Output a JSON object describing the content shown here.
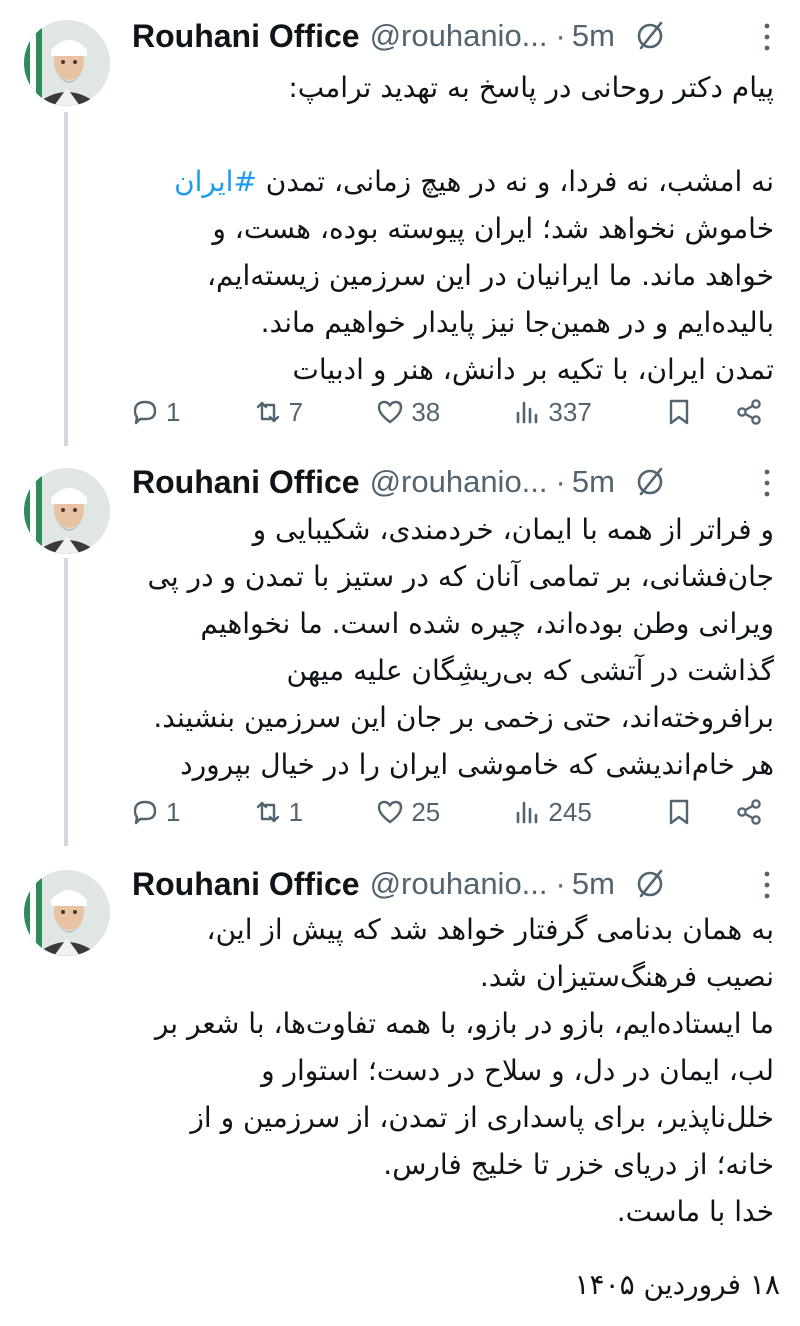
{
  "tweets": [
    {
      "author": {
        "name": "Rouhani Office",
        "handle": "@rouhanio...",
        "separator": "·",
        "time": "5m"
      },
      "lines": [
        {
          "text": "پیام دکتر روحانی در پاسخ به تهدید ترامپ:"
        },
        {
          "text": ""
        },
        {
          "before": "نه امشب، نه فردا، و نه در هیچ زمانی، تمدن ",
          "hashtag": "#ایران",
          "after": ""
        },
        {
          "text": "خاموش نخواهد شد؛ ایران پیوسته بوده، هست، و"
        },
        {
          "text": "خواهد ماند. ما ایرانیان در این سرزمین زیسته‌ایم،"
        },
        {
          "text": "بالیده‌ایم و در همین‌جا نیز پایدار خواهیم ماند."
        },
        {
          "text": "تمدن ایران، با تکیه بر دانش، هنر و ادبیات"
        }
      ],
      "stats": {
        "replies": "1",
        "reposts": "7",
        "likes": "38",
        "views": "337"
      }
    },
    {
      "author": {
        "name": "Rouhani Office",
        "handle": "@rouhanio...",
        "separator": "·",
        "time": "5m"
      },
      "lines": [
        {
          "text": "و فراتر از همه با ایمان، خردمندی، شکیبایی و"
        },
        {
          "text": "جان‌فشانی، بر تمامی آنان که در ستیز با تمدن و در پی"
        },
        {
          "text": "ویرانی وطن بوده‌اند، چیره شده است. ما نخواهیم"
        },
        {
          "text": "گذاشت در آتشی که بی‌ریشِگان علیه میهن"
        },
        {
          "text": "برافروخته‌اند، حتی زخمی بر جان این سرزمین بنشیند."
        },
        {
          "text": "هر خام‌اندیشی که خاموشی ایران را در خیال بپرورد"
        }
      ],
      "stats": {
        "replies": "1",
        "reposts": "1",
        "likes": "25",
        "views": "245"
      }
    },
    {
      "author": {
        "name": "Rouhani Office",
        "handle": "@rouhanio...",
        "separator": "·",
        "time": "5m"
      },
      "lines": [
        {
          "text": "به همان بدنامی گرفتار خواهد شد که پیش از این،"
        },
        {
          "text": "نصیب فرهنگ‌ستیزان شد."
        },
        {
          "text": "ما ایستاده‌ایم، بازو در بازو، با همه تفاوت‌ها، با شعر بر"
        },
        {
          "text": "لب، ایمان در دل، و سلاح در دست؛ استوار و"
        },
        {
          "text": "خلل‌ناپذیر، برای پاسداری از تمدن، از سرزمین و از"
        },
        {
          "text": "خانه؛ از دریای خزر تا خلیج فارس."
        },
        {
          "text": "خدا با ماست."
        }
      ]
    }
  ],
  "date": "۱۸ فروردین ۱۴۰۵",
  "colors": {
    "hashtag": "#1d9bf0",
    "muted": "#536471",
    "thread_line": "#cfd9de"
  }
}
